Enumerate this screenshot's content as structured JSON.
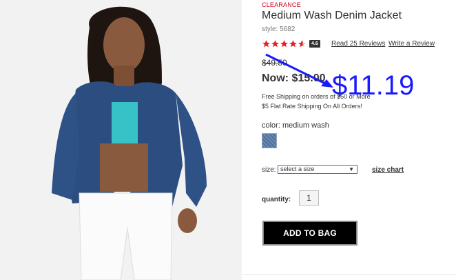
{
  "product": {
    "badge": "CLEARANCE",
    "title": "Medium Wash Denim Jacket",
    "style": "style: 5682",
    "rating_value": "4.6",
    "rating_stars": 4.6,
    "read_reviews": "Read 25 Reviews",
    "write_review": "Write a Review",
    "old_price": "$49.50",
    "now_price": "Now: $15.00",
    "shipping_line1": "Free Shipping on orders of $50 or More",
    "shipping_line2": "$5 Flat Rate Shipping On All Orders!",
    "color_label": "color: medium wash",
    "size_label": "size:",
    "size_select_value": "select a size",
    "size_chart": "size chart",
    "qty_label": "quantity:",
    "qty_value": "1",
    "add_to_bag": "ADD TO BAG"
  },
  "annotation": {
    "price_text": "$11.19",
    "color": "#1a1aff"
  },
  "colors": {
    "clearance": "#d6001c",
    "star": "#e8202a",
    "button_bg": "#000000"
  }
}
